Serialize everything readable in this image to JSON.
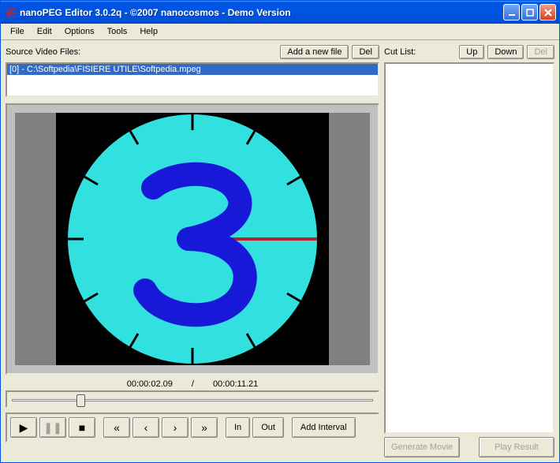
{
  "window": {
    "title": "nanoPEG Editor 3.0.2q  -  ©2007 nanocosmos - Demo Version"
  },
  "menu": {
    "file": "File",
    "edit": "Edit",
    "options": "Options",
    "tools": "Tools",
    "help": "Help"
  },
  "source": {
    "label": "Source Video Files:",
    "add_btn": "Add a new file",
    "del_btn": "Del",
    "items": [
      "[0] - C:\\Softpedia\\FISIERE UTILE\\Softpedia.mpeg"
    ]
  },
  "cutlist": {
    "label": "Cut List:",
    "up_btn": "Up",
    "down_btn": "Down",
    "del_btn": "Del"
  },
  "time": {
    "current": "00:00:02.09",
    "sep": "/",
    "total": "00:00:11.21",
    "slider_percent": 18.7
  },
  "transport": {
    "in_btn": "In",
    "out_btn": "Out",
    "add_interval_btn": "Add Interval"
  },
  "actions": {
    "generate": "Generate Movie",
    "play_result": "Play Result"
  },
  "preview": {
    "countdown_digit": "3"
  },
  "icons": {
    "minimize": "minimize-icon",
    "maximize": "maximize-icon",
    "close": "close-icon",
    "app": "app-icon"
  }
}
